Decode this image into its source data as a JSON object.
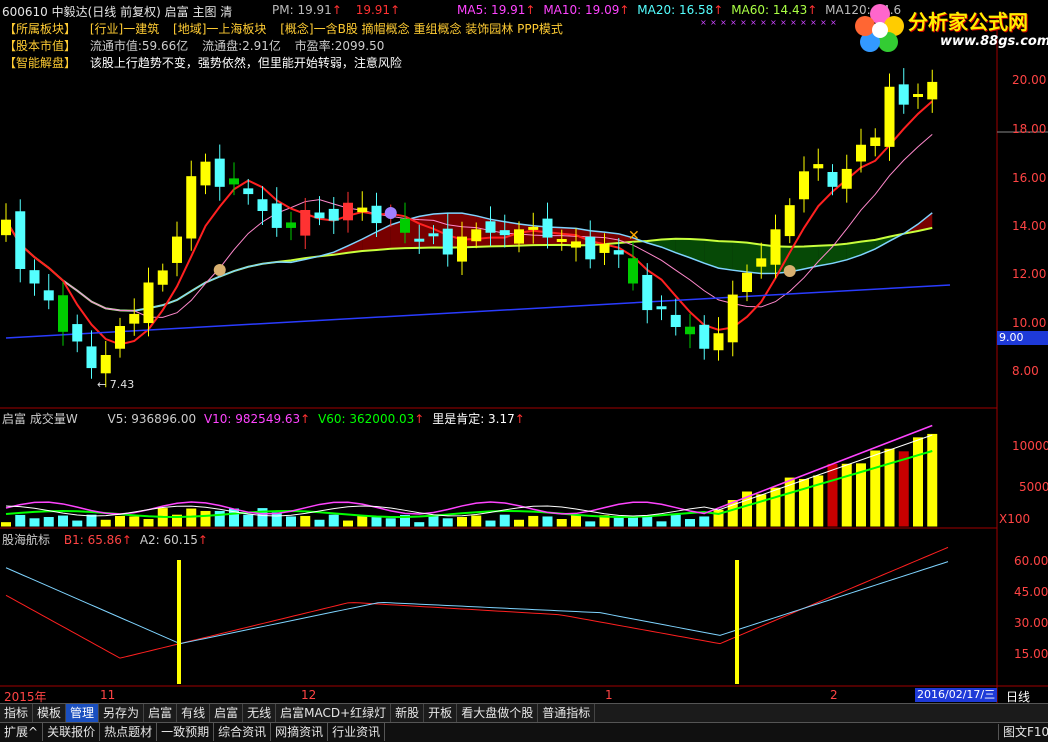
{
  "header": {
    "code_name": "600610 中毅达(日线 前复权)",
    "indicator": "启富 主图 清",
    "pm": "PM: 19.91",
    "pm2": "19.91",
    "ma5": "MA5: 19.91",
    "ma10": "MA10: 19.09",
    "ma20": "MA20: 16.58",
    "ma60": "MA60: 14.43",
    "ma120": "MA120: 14.6"
  },
  "info": {
    "row1_tag": "【所属板块】",
    "industry": "[行业]一建筑",
    "region": "[地域]一上海板块",
    "concept": "[概念]一含B股 摘帽概念 重组概念 装饰园林 PPP模式",
    "row2_tag": "【股本市值】",
    "float_mv": "流通市值:59.66亿",
    "float_shares": "流通盘:2.91亿",
    "pe": "市盈率:2099.50",
    "row3_tag": "【智能解盘】",
    "analysis": "该股上行趋势不变，强势依然，但里能开始转弱，注意风险"
  },
  "logo": {
    "text": "分析家公式网",
    "url": "www.88gs.com"
  },
  "main_axis": {
    "labels": [
      "20.00",
      "18.00",
      "16.00",
      "14.00",
      "12.00",
      "10.00",
      "8.00"
    ],
    "current_price": "9.00"
  },
  "low_label": "7.43",
  "volume": {
    "title": "启富 成交量W",
    "v5": "V5: 936896.00",
    "v10": "V10: 982549.63",
    "v60": "V60: 362000.03",
    "qi": "里是肯定: 3.17",
    "axis": [
      "10000",
      "5000"
    ],
    "unit": "X100"
  },
  "sub": {
    "title": "股海航标",
    "b1": "B1: 65.86",
    "a2": "A2: 60.15",
    "axis": [
      "60.00",
      "45.00",
      "30.00",
      "15.00"
    ]
  },
  "dates": {
    "year": "2015年",
    "m11": "11",
    "m12": "12",
    "m1": "1",
    "m2": "2",
    "current": "2016/02/17/三",
    "period": "日线"
  },
  "toolbar1": [
    "指标",
    "模板",
    "管理",
    "另存为",
    "启富",
    "有线",
    "启富",
    "无线",
    "启富MACD+红绿灯",
    "新股",
    "开板",
    "看大盘做个股",
    "普通指标"
  ],
  "toolbar1_active": 2,
  "toolbar2": [
    "扩展^",
    "关联报价",
    "热点题材",
    "一致预期",
    "综合资讯",
    "网摘资讯",
    "行业资讯"
  ],
  "corner": "图文F10",
  "colors": {
    "up": "#ff3232",
    "down": "#54ffff",
    "yellow": "#ffff00",
    "green": "#00cc00",
    "ma_blue": "#3050ff"
  }
}
